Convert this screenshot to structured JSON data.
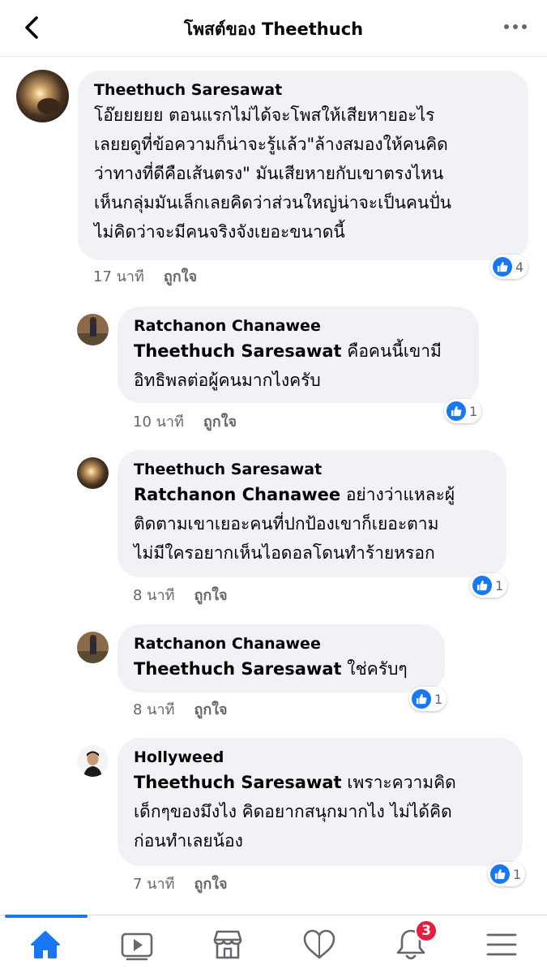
{
  "header": {
    "title": "โพสต์ของ Theethuch"
  },
  "comments": [
    {
      "author": "Theethuch Saresawat",
      "mention": "",
      "lines": [
        "โอ๊ยยยยย ตอนแรกไม่ได้จะโพสให้เสียหายอะไร",
        "เลยยดูที่ข้อความก็น่าจะรู้แล้ว\"ล้างสมองให้คนคิด",
        "ว่าทางที่ดีคือเส้นตรง\" มันเสียหายกับเขาตรงไหน",
        "เห็นกลุ่มมันเล็กเลยคิดว่าส่วนใหญ่น่าจะเป็นคนปั่น",
        "ไม่คิดว่าจะมีคนจริงจังเยอะขนาดนี้"
      ],
      "time": "17 นาที",
      "like_label": "ถูกใจ",
      "reactions": "4"
    },
    {
      "author": "Ratchanon Chanawee",
      "mention": "Theethuch Saresawat",
      "lines": [
        " คือคนนี้เขามี",
        "อิทธิพลต่อผู้คนมากไงครับ"
      ],
      "time": "10 นาที",
      "like_label": "ถูกใจ",
      "reactions": "1"
    },
    {
      "author": "Theethuch Saresawat",
      "mention": "Ratchanon Chanawee",
      "lines": [
        " อย่างว่าแหละผู้",
        "ติดตามเขาเยอะคนที่ปกป้องเขาก็เยอะตาม",
        "ไม่มีใครอยากเห็นไอดอลโดนทำร้ายหรอก"
      ],
      "time": "8 นาที",
      "like_label": "ถูกใจ",
      "reactions": "1"
    },
    {
      "author": "Ratchanon Chanawee",
      "mention": "Theethuch Saresawat",
      "lines": [
        " ใช่ครับๆ"
      ],
      "time": "8 นาที",
      "like_label": "ถูกใจ",
      "reactions": "1"
    },
    {
      "author": "Hollyweed",
      "mention": "Theethuch Saresawat",
      "lines": [
        " เพราะความคิด",
        "เด็กๆของมึงไง คิดอยากสนุกมากไง ไม่ได้คิด",
        "ก่อนทำเลยน้อง"
      ],
      "time": "7 นาที",
      "like_label": "ถูกใจ",
      "reactions": "1"
    }
  ],
  "nav": {
    "notification_count": "3",
    "items": [
      "home-icon",
      "video-icon",
      "marketplace-icon",
      "dating-heart-icon",
      "notifications-bell-icon",
      "menu-icon"
    ]
  },
  "colors": {
    "accent": "#1877f2",
    "bubble": "#f0f2f5",
    "meta": "#65676b",
    "badge": "#e41e3f"
  }
}
